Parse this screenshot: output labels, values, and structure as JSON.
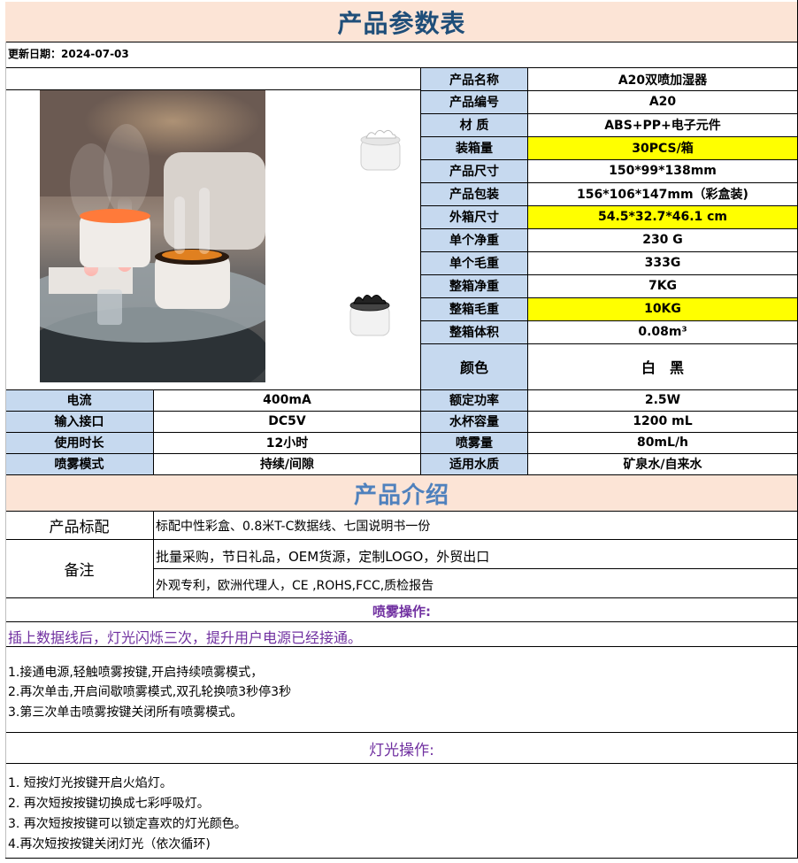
{
  "title": "产品参数表",
  "update_date": "更新日期：2024-07-03",
  "specs": [
    {
      "label": "产品名称",
      "value": "A20双喷加湿器",
      "highlight": false
    },
    {
      "label": "产品编号",
      "value": "A20",
      "highlight": false
    },
    {
      "label": "材 质",
      "value": "ABS+PP+电子元件",
      "highlight": false
    },
    {
      "label": "装箱量",
      "value": "30PCS/箱",
      "highlight": true
    },
    {
      "label": "产品尺寸",
      "value": "150*99*138mm",
      "highlight": false
    },
    {
      "label": "产品包装",
      "value": "156*106*147mm（彩盒装)",
      "highlight": false
    },
    {
      "label": "外箱尺寸",
      "value": "54.5*32.7*46.1 cm",
      "highlight": true
    },
    {
      "label": "单个净重",
      "value": "230 G",
      "highlight": false
    },
    {
      "label": "单个毛重",
      "value": "333G",
      "highlight": false
    },
    {
      "label": "整箱净重",
      "value": "7KG",
      "highlight": false
    },
    {
      "label": "整箱毛重",
      "value": "10KG",
      "highlight": true
    },
    {
      "label": "整箱体积",
      "value": "0.08m³",
      "highlight": false
    }
  ],
  "color_label": "颜色",
  "color_value": "白　黑",
  "params": [
    {
      "label1": "电流",
      "value1": "400mA",
      "label2": "额定功率",
      "value2": "2.5W"
    },
    {
      "label1": "输入接口",
      "value1": "DC5V",
      "label2": "水杯容量",
      "value2": "1200 mL"
    },
    {
      "label1": "使用时长",
      "value1": "12小时",
      "label2": "喷雾量",
      "value2": "80mL/h"
    },
    {
      "label1": "喷雾模式",
      "value1": "持续/间隙",
      "label2": "适用水质",
      "value2": "矿泉水/自来水"
    }
  ],
  "intro_title": "产品介绍",
  "standard_label": "产品标配",
  "standard_value": "标配中性彩盒、0.8米T-C数据线、七国说明书一份",
  "remarks_label": "备注",
  "remarks": [
    "批量采购，节日礼品，OEM货源，定制LOGO，外贸出口",
    "外观专利，欧洲代理人，CE ,ROHS,FCC,质检报告"
  ],
  "spray_title": "喷雾操作:",
  "spray_note": "插上数据线后，灯光闪烁三次，提升用户电源已经接通。",
  "spray_steps": [
    "1.接通电源,轻触喷雾按键,开启持续喷雾模式，",
    "2.再次单击,开启间歇喷雾模式,双孔轮换喷3秒停3秒",
    "3.第三次单击喷雾按键关闭所有喷雾模式。"
  ],
  "light_title": "灯光操作:",
  "light_steps": [
    "1. 短按灯光按键开启火焰灯。",
    "2. 再次短按按键切换成七彩呼吸灯。",
    "3. 再次短按按键可以锁定喜欢的灯光颜色。",
    "4.再次短按按键关闭灯光（依次循环)"
  ],
  "colors": {
    "title_band": "#fce4d6",
    "title_text": "#1f4e79",
    "intro_text": "#4f81bd",
    "label_bg": "#c6d9ef",
    "highlight": "#ffff00",
    "purple": "#7030a0"
  }
}
